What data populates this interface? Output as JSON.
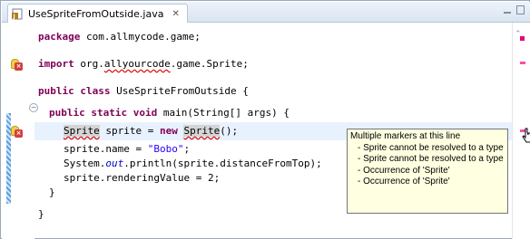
{
  "tab": {
    "title": "UseSpriteFromOutside.java",
    "close": "✕"
  },
  "code": {
    "l1_kw": "package",
    "l1_rest": " com.allmycode.game;",
    "l3_kw": "import",
    "l3_a": " org.",
    "l3_b": "allyourcode",
    "l3_c": ".game.Sprite;",
    "l5_kw1": "public",
    "l5_kw2": "class",
    "l5_rest": " UseSpriteFromOutside {",
    "l7_kw1": "public",
    "l7_kw2": "static",
    "l7_kw3": "void",
    "l7_rest": " main(String[] args) {",
    "l8_type": "Sprite",
    "l8_a": " sprite = ",
    "l8_kw": "new",
    "l8_b": " ",
    "l8_ctor": "Sprite",
    "l8_c": "();",
    "l9_a": "sprite.name = ",
    "l9_str": "\"Bobo\"",
    "l9_b": ";",
    "l10_a": "System.",
    "l10_out": "out",
    "l10_b": ".println(sprite.distanceFromTop);",
    "l11": "sprite.renderingValue = 2;",
    "l12": "}",
    "l14": "}"
  },
  "tooltip": {
    "header": "Multiple markers at this line",
    "items": [
      "- Sprite cannot be resolved to a type",
      "- Sprite cannot be resolved to a type",
      "- Occurrence of 'Sprite'",
      "- Occurrence of 'Sprite'"
    ]
  },
  "colors": {
    "keyword": "#7f0055",
    "string": "#2a00ff",
    "error": "#e00000",
    "tooltip_bg": "#ffffe1"
  },
  "icons": [
    "java-file-icon",
    "close-icon",
    "minimize-icon",
    "maximize-icon",
    "error-marker-icon",
    "collapse-icon",
    "mouse-cursor-icon"
  ]
}
